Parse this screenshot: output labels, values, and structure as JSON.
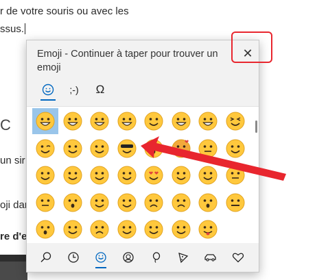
{
  "document": {
    "line1": "r de votre souris ou avec les",
    "line2": "ssus.",
    "line3": "C",
    "line4": "un sir",
    "line5": "oji dar",
    "line6": "re d'e"
  },
  "panel": {
    "title": "Emoji - Continuer à taper pour trouver un emoji",
    "close_glyph": "✕",
    "tabs": [
      {
        "label": "☺",
        "name": "emoji"
      },
      {
        "label": ";-)",
        "name": "kaomoji"
      },
      {
        "label": "Ω",
        "name": "symbols"
      }
    ],
    "active_tab": "emoji",
    "selected_emoji_index": 0,
    "subcategories": [
      "search-icon",
      "clock-icon",
      "smiley-icon",
      "people-icon",
      "balloon-icon",
      "pizza-icon",
      "car-icon",
      "heart-icon"
    ],
    "active_subcategory": "smiley-icon"
  },
  "colors": {
    "accent": "#0067c0",
    "annotation_red": "#e8262e",
    "emoji_yellow": "#ffc83d",
    "selection": "#99c5ea"
  }
}
